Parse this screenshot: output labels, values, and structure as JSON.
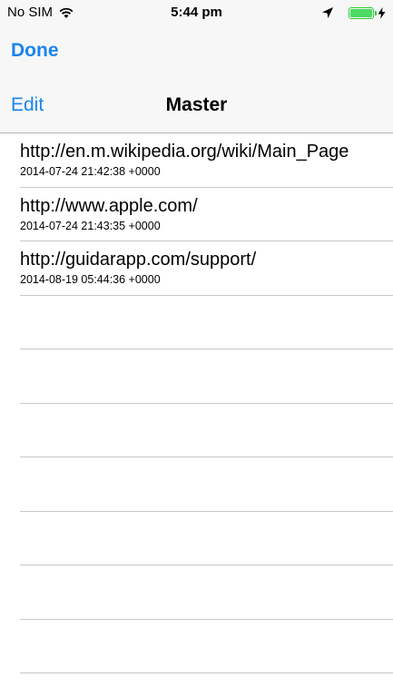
{
  "status_bar": {
    "carrier": "No SIM",
    "time": "5:44 pm"
  },
  "nav": {
    "done_label": "Done",
    "edit_label": "Edit",
    "title": "Master"
  },
  "colors": {
    "tint": "#1a84f0",
    "battery": "#4cd964",
    "separator": "#c8c7cc"
  },
  "rows": [
    {
      "title": "http://en.m.wikipedia.org/wiki/Main_Page",
      "subtitle": "2014-07-24 21:42:38 +0000"
    },
    {
      "title": "http://www.apple.com/",
      "subtitle": "2014-07-24 21:43:35 +0000"
    },
    {
      "title": "http://guidarapp.com/support/",
      "subtitle": "2014-08-19 05:44:36 +0000"
    }
  ]
}
